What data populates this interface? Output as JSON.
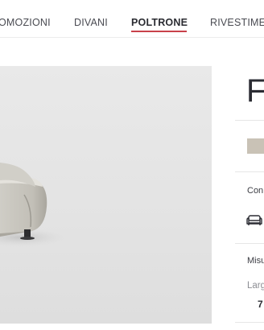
{
  "nav": {
    "items": [
      {
        "label": "OMOZIONI"
      },
      {
        "label": "DIVANI"
      },
      {
        "label": "POLTRONE"
      },
      {
        "label": "RIVESTIMEN"
      }
    ],
    "active_index": 2,
    "active_underline_color": "#c8414a"
  },
  "product": {
    "title_fragment": "F",
    "swatch_color": "#c9c2b6",
    "section_config_label": "Con",
    "section_measures_label": "Misu",
    "width_label": "Larg",
    "width_value": "7",
    "config_icon": "sofa-icon"
  }
}
